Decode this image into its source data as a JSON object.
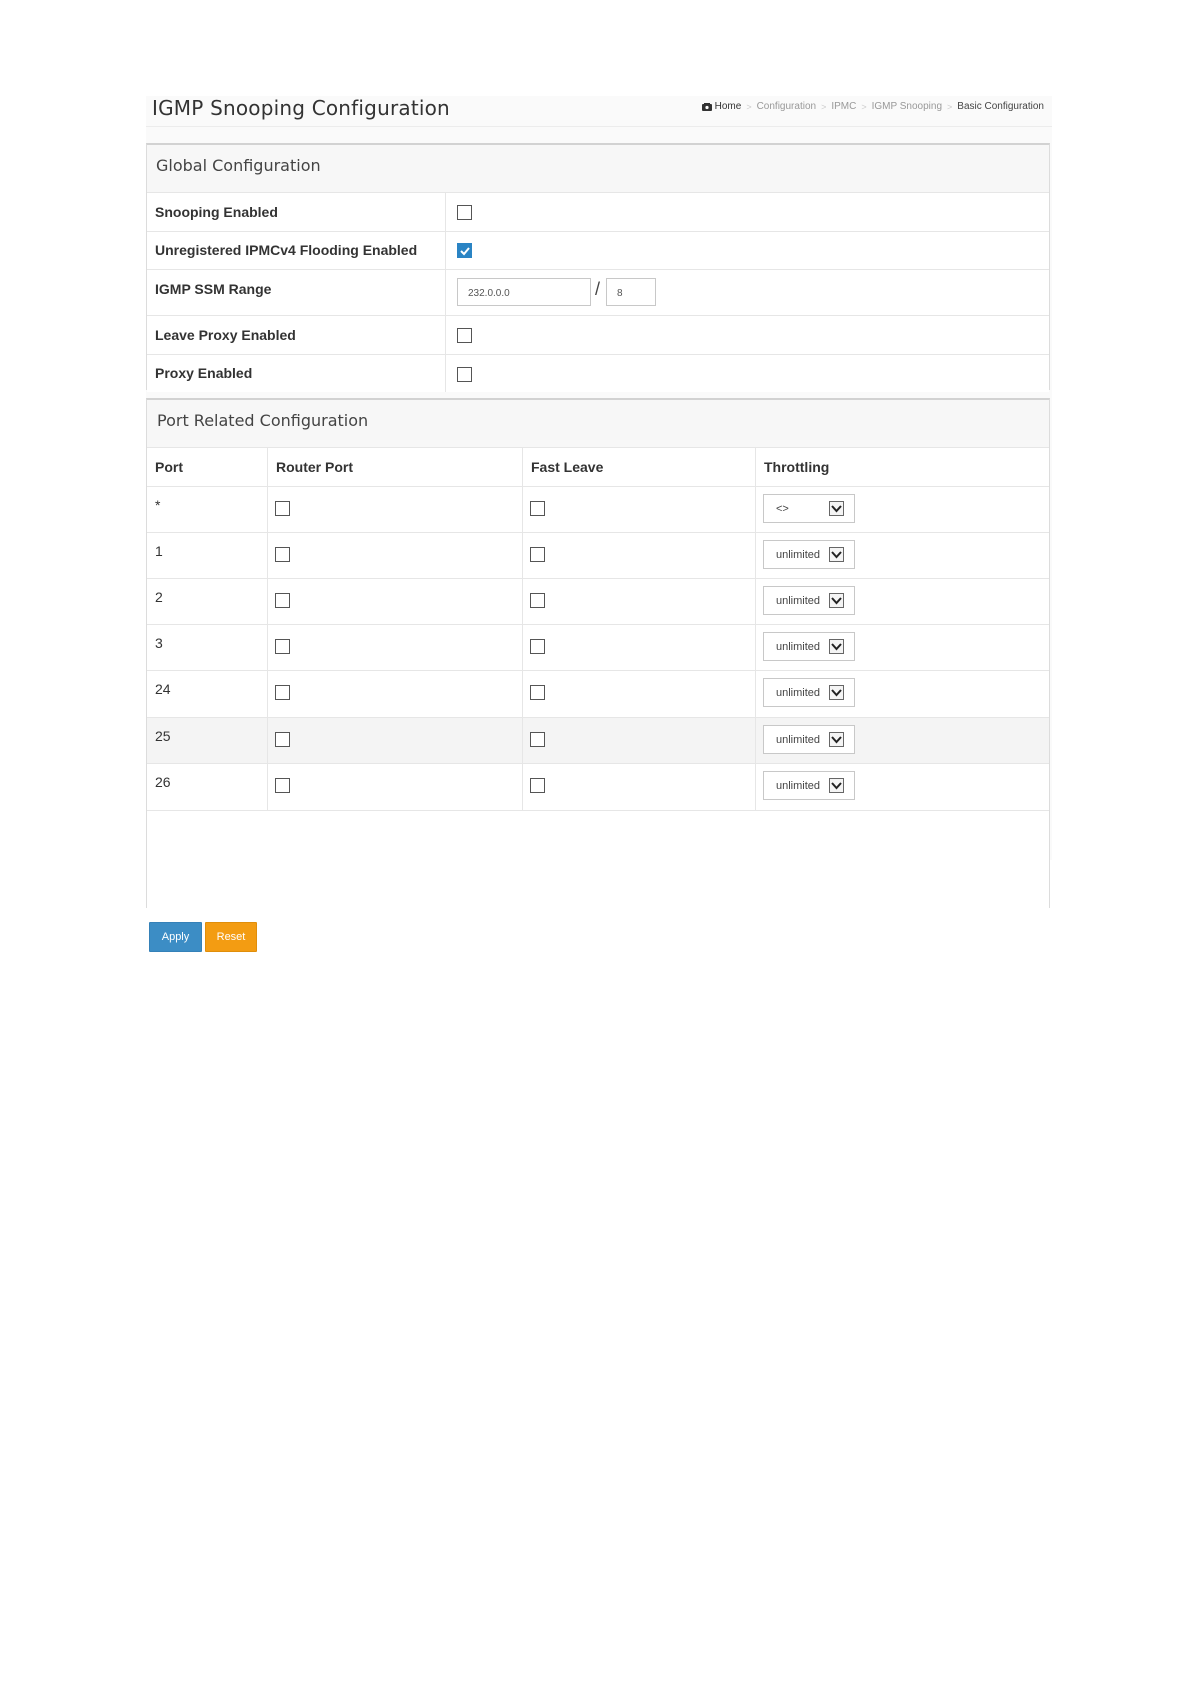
{
  "page": {
    "title": "IGMP Snooping Configuration"
  },
  "breadcrumb": [
    "Home",
    "Configuration",
    "IPMC",
    "IGMP Snooping",
    "Basic Configuration"
  ],
  "global": {
    "title": "Global Configuration",
    "rows": [
      {
        "label": "Snooping Enabled",
        "checked": false
      },
      {
        "label": "Unregistered IPMCv4 Flooding Enabled",
        "checked": true
      },
      {
        "label": "IGMP SSM Range",
        "address": "232.0.0.0",
        "prefix": "8"
      },
      {
        "label": "Leave Proxy Enabled",
        "checked": false
      },
      {
        "label": "Proxy Enabled",
        "checked": false
      }
    ],
    "ssm_separator": "/"
  },
  "ports": {
    "title": "Port Related Configuration",
    "headers": [
      "Port",
      "Router Port",
      "Fast Leave",
      "Throttling"
    ],
    "rows": [
      {
        "port": "*",
        "router_port": false,
        "fast_leave": false,
        "throttling": "<>"
      },
      {
        "port": "1",
        "router_port": false,
        "fast_leave": false,
        "throttling": "unlimited"
      },
      {
        "port": "2",
        "router_port": false,
        "fast_leave": false,
        "throttling": "unlimited"
      },
      {
        "port": "3",
        "router_port": false,
        "fast_leave": false,
        "throttling": "unlimited"
      },
      {
        "port": "24",
        "router_port": false,
        "fast_leave": false,
        "throttling": "unlimited"
      },
      {
        "port": "25",
        "router_port": false,
        "fast_leave": false,
        "throttling": "unlimited"
      },
      {
        "port": "26",
        "router_port": false,
        "fast_leave": false,
        "throttling": "unlimited"
      }
    ]
  },
  "buttons": {
    "apply": "Apply",
    "reset": "Reset"
  },
  "colors": {
    "checkbox_checked": "#2a84c4",
    "apply": "#3c8dc5",
    "reset": "#f39c12"
  }
}
